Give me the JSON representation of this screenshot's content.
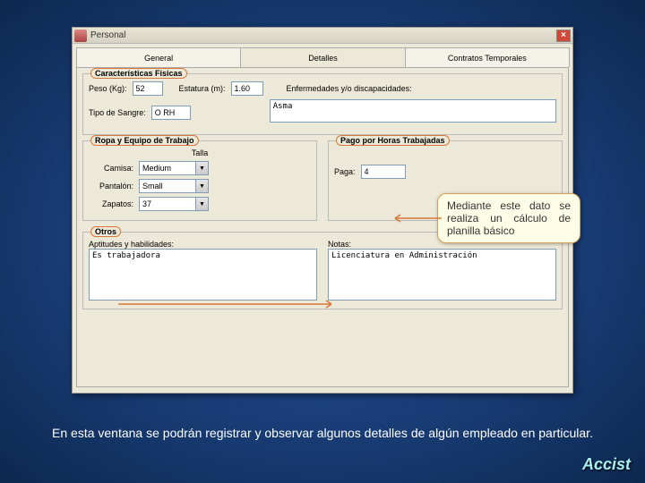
{
  "window": {
    "title": "Personal"
  },
  "tabs": {
    "general": "General",
    "detalles": "Detalles",
    "contratos": "Contratos Temporales"
  },
  "groups": {
    "fisicas": "Características Físicas",
    "ropa": "Ropa y Equipo de Trabajo",
    "pago": "Pago por Horas Trabajadas",
    "otros": "Otros"
  },
  "fisicas": {
    "peso_lbl": "Peso (Kg):",
    "peso_val": "52",
    "estatura_lbl": "Estatura (m):",
    "estatura_val": "1.60",
    "enferm_lbl": "Enfermedades y/o discapacidades:",
    "enferm_val": "Asma",
    "sangre_lbl": "Tipo de Sangre:",
    "sangre_val": "O RH"
  },
  "ropa": {
    "talla_lbl": "Talla",
    "camisa_lbl": "Camisa:",
    "camisa_val": "Medium",
    "pantalon_lbl": "Pantalón:",
    "pantalon_val": "Small",
    "zapatos_lbl": "Zapatos:",
    "zapatos_val": "37"
  },
  "pago": {
    "paga_lbl": "Paga:",
    "paga_val": "4"
  },
  "otros": {
    "aptitudes_lbl": "Aptitudes y habilidades:",
    "aptitudes_val": "Es trabajadora",
    "notas_lbl": "Notas:",
    "notas_val": "Licenciatura en Administración"
  },
  "callout": "Mediante este dato se realiza un cálculo de planilla básico",
  "caption": "En esta ventana se podrán registrar y observar algunos detalles de algún  empleado en particular.",
  "logo": "Accist"
}
